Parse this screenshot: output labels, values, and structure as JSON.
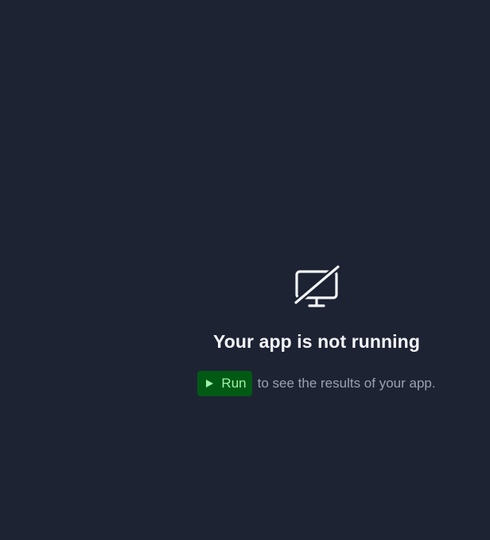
{
  "empty_state": {
    "icon": "monitor-off-icon",
    "title": "Your app is not running",
    "run_button_label": "Run",
    "run_button_icon": "play-icon",
    "hint": "to see the results of your app."
  },
  "colors": {
    "background": "#1d2333",
    "title": "#f4f5f8",
    "hint": "#9aa1b2",
    "run_button_background": "#005a14",
    "run_button_text": "#9ef0a6"
  }
}
